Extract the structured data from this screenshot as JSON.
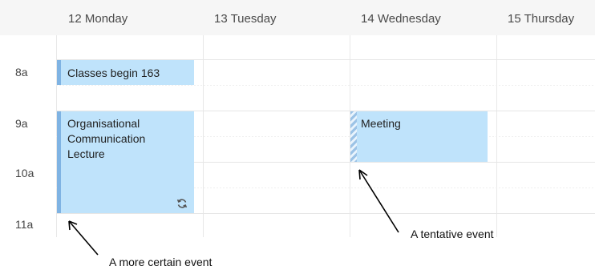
{
  "days": [
    {
      "label": "12 Monday"
    },
    {
      "label": "13 Tuesday"
    },
    {
      "label": "14 Wednesday"
    },
    {
      "label": "15 Thursday"
    }
  ],
  "times": [
    "8a",
    "9a",
    "10a",
    "11a"
  ],
  "events": {
    "classes": {
      "title": "Classes begin 163"
    },
    "lecture": {
      "title": "Organisational Communication Lecture",
      "recurring_icon": "recurring-icon"
    },
    "meeting": {
      "title": "Meeting",
      "status": "tentative"
    }
  },
  "annotations": {
    "tentative": "A tentative event",
    "certain": "A more certain event"
  },
  "colors": {
    "event_fill": "#bfe3fb",
    "event_bar": "#7fb3e3",
    "header_bg": "#f6f6f6"
  }
}
